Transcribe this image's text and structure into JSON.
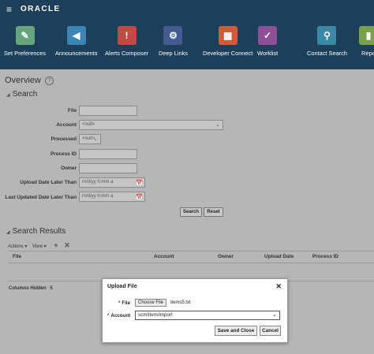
{
  "header": {
    "brand": "ORACLE",
    "nav": [
      {
        "label": "Set Preferences",
        "icon": "user-settings-icon",
        "color": "#67a37b",
        "glyph": "✎"
      },
      {
        "label": "Announcements",
        "icon": "megaphone-icon",
        "color": "#3b86b4",
        "glyph": "◀"
      },
      {
        "label": "Alerts Composer",
        "icon": "alert-icon",
        "color": "#c24a45",
        "glyph": "!"
      },
      {
        "label": "Deep Links",
        "icon": "links-icon",
        "color": "#455a93",
        "glyph": "⚙"
      },
      {
        "label": "Developer Connect",
        "icon": "developer-icon",
        "color": "#cd5d3a",
        "glyph": "▦"
      },
      {
        "label": "Worklist",
        "icon": "checklist-icon",
        "color": "#8e4f97",
        "glyph": "✓"
      },
      {
        "label": "Contact Search",
        "icon": "contact-search-icon",
        "color": "#3a88a6",
        "glyph": "⚲"
      },
      {
        "label": "Repo\nAna",
        "icon": "reports-icon",
        "color": "#79a04c",
        "glyph": "▮"
      }
    ]
  },
  "overview": {
    "title": "Overview"
  },
  "search": {
    "title": "Search",
    "fields": {
      "file": {
        "label": "File",
        "value": ""
      },
      "account": {
        "label": "Account",
        "value": "<null>"
      },
      "processed": {
        "label": "Processed",
        "value": "<null>"
      },
      "process_id": {
        "label": "Process ID",
        "value": ""
      },
      "owner": {
        "label": "Owner",
        "value": ""
      },
      "upload_date": {
        "label": "Upload Date Later Than",
        "placeholder": "m/d/yy h:mm a"
      },
      "last_updated": {
        "label": "Last Updated Date Later Than",
        "placeholder": "m/d/yy h:mm a"
      }
    },
    "search_button": "Search",
    "reset_button": "Reset"
  },
  "results": {
    "title": "Search Results",
    "actions_label": "Actions ▾",
    "view_label": "View ▾",
    "columns": [
      "File",
      "Account",
      "Owner",
      "Upload Date",
      "Process ID"
    ],
    "columns_hidden_label": "Columns Hidden",
    "columns_hidden_count": "5"
  },
  "dialog": {
    "title": "Upload File",
    "file_label": "File",
    "choose_button": "Choose File",
    "file_name": "items5.txt",
    "account_label": "Account",
    "account_value": "scm/item/import",
    "save_close_button": "Save and Close",
    "cancel_button": "Cancel"
  }
}
